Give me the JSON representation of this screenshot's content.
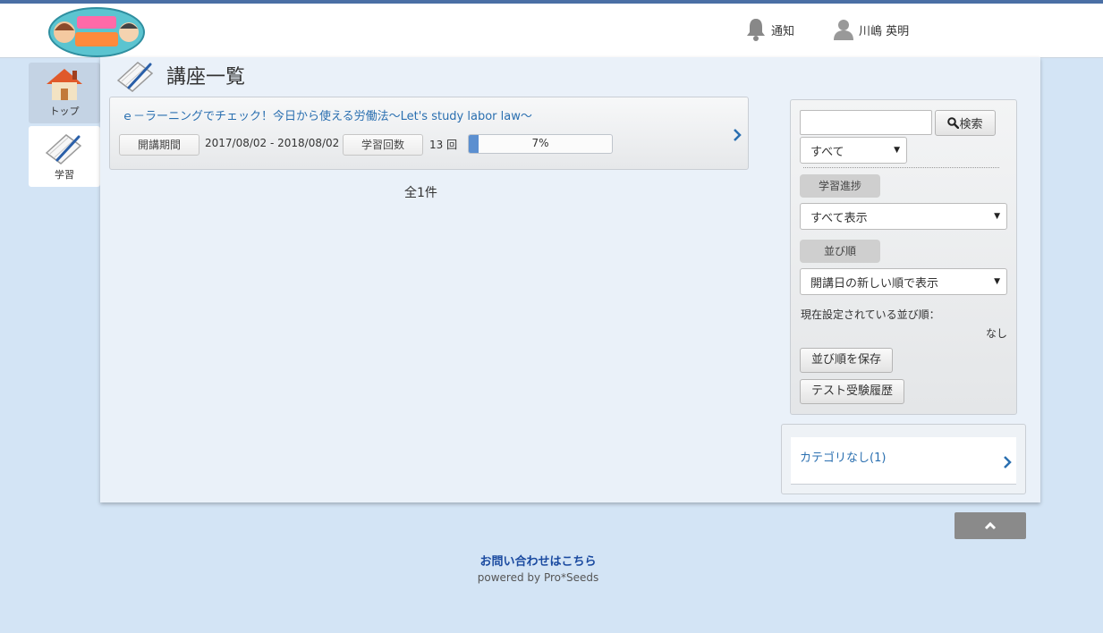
{
  "header": {
    "notify_label": "通知",
    "user_name": "川嶋 英明",
    "accent": "#4a6fa5"
  },
  "sidenav": {
    "items": [
      {
        "label": "トップ",
        "icon": "house-icon"
      },
      {
        "label": "学習",
        "icon": "notebook-pen-icon"
      }
    ]
  },
  "main": {
    "title": "講座一覧",
    "course": {
      "title": "ｅ－ラーニングでチェック！今日から使える労働法～Let's study labor law～",
      "period_label": "開講期間",
      "period_value": "2017/08/02 - 2018/08/02",
      "count_label": "学習回数",
      "count_value": "13 回",
      "progress_text": "7%",
      "progress_fraction": 0.07
    },
    "total": "全1件"
  },
  "filter": {
    "search_button": "検索",
    "search_value": "",
    "scope_select": "すべて",
    "progress_label": "学習進捗",
    "progress_select": "すべて表示",
    "order_label": "並び順",
    "order_select": "開講日の新しい順で表示",
    "current_order_label": "現在設定されている並び順：",
    "current_order_value": "なし",
    "save_button": "並び順を保存",
    "history_button": "テスト受験履歴"
  },
  "categories": {
    "items": [
      {
        "label": "カテゴリなし(1)"
      }
    ]
  },
  "footer": {
    "contact_link": "お問い合わせはこちら",
    "powered": "powered by Pro*Seeds"
  }
}
